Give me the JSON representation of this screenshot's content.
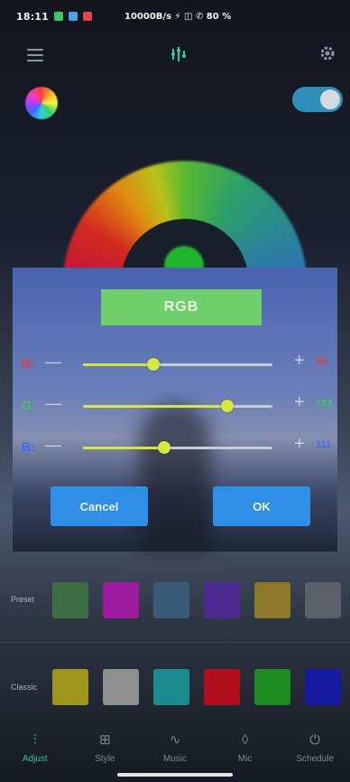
{
  "status_bar": {
    "time": "18:11",
    "right_text": "10000B/s ⚡ ◫ ✆ 80 %",
    "notif_colors": [
      "#3fc46a",
      "#4aa3e6",
      "#e24a4a"
    ]
  },
  "top_bar": {
    "menu_icon": "menu-icon",
    "center_icon": "equalizer-icon",
    "settings_icon": "gear-icon"
  },
  "power": {
    "on": true
  },
  "color_wheel": {
    "thumb_color": "#1fb52d"
  },
  "dialog": {
    "title": "RGB",
    "channels": [
      {
        "label": "R:",
        "label_color": "#e04040",
        "value": 94,
        "fraction": 0.37
      },
      {
        "label": "G:",
        "label_color": "#3fc46a",
        "value": 193,
        "fraction": 0.76
      },
      {
        "label": "B:",
        "label_color": "#3a6cff",
        "value": 111,
        "fraction": 0.43
      }
    ],
    "minus_label": "—",
    "plus_label": "+",
    "cancel_label": "Cancel",
    "ok_label": "OK"
  },
  "preset": {
    "label": "Preset",
    "swatches": [
      "#3f6e45",
      "#9b1a9e",
      "#3b5a78",
      "#4b2a8f",
      "#8c7a2a",
      "#5c6068"
    ]
  },
  "classic": {
    "label": "Classic",
    "swatches": [
      "#9e961c",
      "#8f8f8f",
      "#1a8c8c",
      "#b0101c",
      "#1c8c22",
      "#161a9e"
    ]
  },
  "bottom_nav": [
    {
      "label": "Adjust",
      "icon": "adjust-icon",
      "glyph": "⫶",
      "active": true
    },
    {
      "label": "Style",
      "icon": "style-icon",
      "glyph": "⊞",
      "active": false
    },
    {
      "label": "Music",
      "icon": "music-icon",
      "glyph": "∿",
      "active": false
    },
    {
      "label": "Mic",
      "icon": "mic-icon",
      "glyph": "◊",
      "active": false
    },
    {
      "label": "Schedule",
      "icon": "schedule-icon",
      "glyph": "⏻",
      "active": false
    }
  ],
  "colors": {
    "accent_green": "#2ec4a0",
    "button_blue": "#2f8ee6",
    "rgb_title_bg": "#6fd06b",
    "slider_fill": "#d8e63a"
  }
}
